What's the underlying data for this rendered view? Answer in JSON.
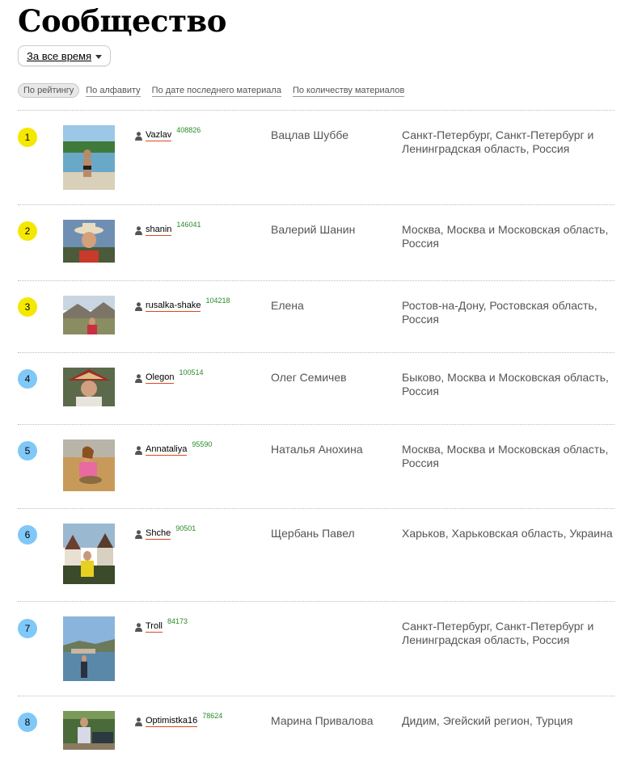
{
  "page": {
    "title": "Сообщество"
  },
  "period": {
    "label": "За все время"
  },
  "sort_tabs": [
    {
      "label": "По рейтингу",
      "active": true
    },
    {
      "label": "По алфавиту",
      "active": false
    },
    {
      "label": "По дате последнего материала",
      "active": false
    },
    {
      "label": "По количеству материалов",
      "active": false
    }
  ],
  "colors": {
    "rank_top": "#f5e800",
    "rank_normal": "#7fc8f8",
    "score": "#2a8a2a",
    "login_underline": "#d94a1e"
  },
  "members": [
    {
      "rank": "1",
      "login": "Vazlav",
      "score": "408826",
      "name": "Вацлав Шуббе",
      "location": "Санкт-Петербург, Санкт-Петербург и Ленинградская область, Россия",
      "photo": "beach"
    },
    {
      "rank": "2",
      "login": "shanin",
      "score": "146041",
      "name": "Валерий Шанин",
      "location": "Москва, Москва и Московская область, Россия",
      "photo": "hat"
    },
    {
      "rank": "3",
      "login": "rusalka-shake",
      "score": "104218",
      "name": "Елена",
      "location": "Ростов-на-Дону, Ростовская область, Россия",
      "photo": "mountain"
    },
    {
      "rank": "4",
      "login": "Olegon",
      "score": "100514",
      "name": "Олег Семичев",
      "location": "Быково, Москва и Московская область, Россия",
      "photo": "straw-hat"
    },
    {
      "rank": "5",
      "login": "Annataliya",
      "score": "95590",
      "name": "Наталья Анохина",
      "location": "Москва, Москва и Московская область, Россия",
      "photo": "desert"
    },
    {
      "rank": "6",
      "login": "Shche",
      "score": "90501",
      "name": "Щербань Павел",
      "location": "Харьков, Харьковская область, Украина",
      "photo": "town"
    },
    {
      "rank": "7",
      "login": "Troll",
      "score": "84173",
      "name": "",
      "location": "Санкт-Петербург, Санкт-Петербург и Ленинградская область, Россия",
      "photo": "coast"
    },
    {
      "rank": "8",
      "login": "Optimistka16",
      "score": "78624",
      "name": "Марина Привалова",
      "location": "Дидим, Эгейский регион, Турция",
      "photo": "garden"
    }
  ]
}
